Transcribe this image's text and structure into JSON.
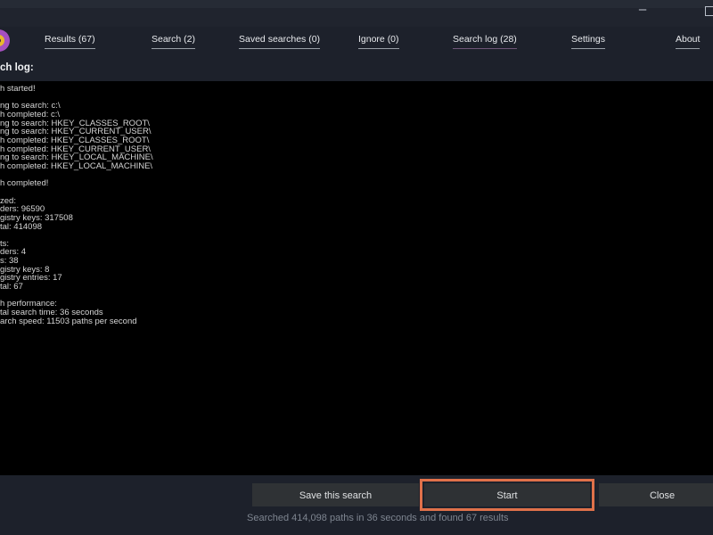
{
  "window": {
    "controls": {
      "minimize_glyph": "–"
    }
  },
  "nav": {
    "tabs": [
      {
        "label": "Results (67)",
        "active": false
      },
      {
        "label": "Search (2)",
        "active": false
      },
      {
        "label": "Saved searches (0)",
        "active": false
      },
      {
        "label": "Ignore (0)",
        "active": false
      },
      {
        "label": "Search log (28)",
        "active": true
      },
      {
        "label": "Settings",
        "active": false
      },
      {
        "label": "About",
        "active": false
      }
    ]
  },
  "section": {
    "label": "ch log:"
  },
  "log": {
    "lines": [
      "h started!",
      "",
      "ng to search: c:\\",
      "h completed: c:\\",
      "ng to search: HKEY_CLASSES_ROOT\\",
      "ng to search: HKEY_CURRENT_USER\\",
      "h completed: HKEY_CLASSES_ROOT\\",
      "h completed: HKEY_CURRENT_USER\\",
      "ng to search: HKEY_LOCAL_MACHINE\\",
      "h completed: HKEY_LOCAL_MACHINE\\",
      "",
      "h completed!",
      "",
      "zed:",
      "ders: 96590",
      "gistry keys: 317508",
      "tal: 414098",
      "",
      "ts:",
      "ders: 4",
      "s: 38",
      "gistry keys: 8",
      "gistry entries: 17",
      "tal: 67",
      "",
      "h performance:",
      "tal search time: 36 seconds",
      "arch speed: 11503 paths per second"
    ]
  },
  "footer": {
    "save_label": "Save this search",
    "start_label": "Start",
    "close_label": "Close",
    "status": "Searched 414,098 paths in 36 seconds and found 67 results"
  },
  "colors": {
    "window_bg": "#1d212b",
    "log_bg": "#000000",
    "highlight_border": "#e0714a",
    "active_tab_underline": "#6e5578",
    "logo_purple": "#a550c0",
    "logo_yellow": "#e9b92c"
  }
}
